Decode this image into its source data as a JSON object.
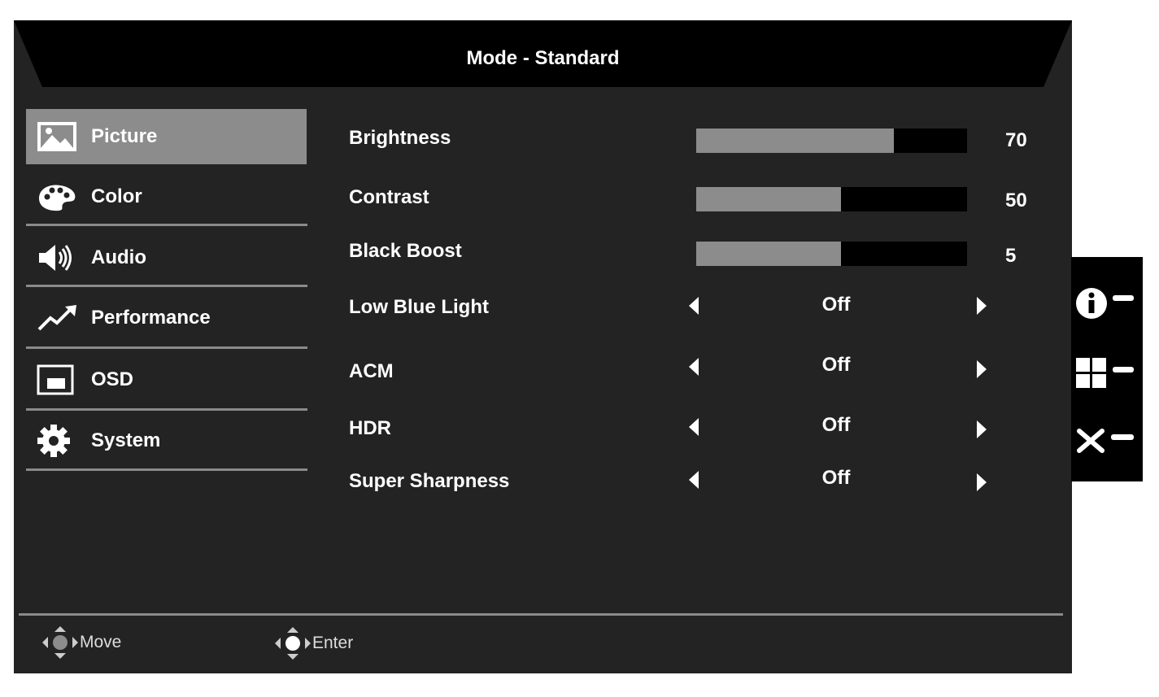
{
  "title": "Mode - Standard",
  "menu": [
    {
      "label": "Picture",
      "icon": "picture-icon",
      "active": true
    },
    {
      "label": "Color",
      "icon": "palette-icon",
      "active": false
    },
    {
      "label": "Audio",
      "icon": "speaker-icon",
      "active": false
    },
    {
      "label": "Performance",
      "icon": "trend-up-icon",
      "active": false
    },
    {
      "label": "OSD",
      "icon": "osd-window-icon",
      "active": false
    },
    {
      "label": "System",
      "icon": "gear-icon",
      "active": false
    }
  ],
  "sliders": [
    {
      "label": "Brightness",
      "value": "70",
      "level": 0.73
    },
    {
      "label": "Contrast",
      "value": "50",
      "level": 0.535
    },
    {
      "label": "Black Boost",
      "value": "5",
      "level": 0.535
    }
  ],
  "options": [
    {
      "label": "Low Blue Light",
      "value": "Off"
    },
    {
      "label": "ACM",
      "value": "Off"
    },
    {
      "label": "HDR",
      "value": "Off"
    },
    {
      "label": "Super Sharpness",
      "value": "Off"
    }
  ],
  "hints": {
    "move": "Move",
    "enter": "Enter"
  },
  "side_keys": [
    "info-key-icon",
    "input-grid-key-icon",
    "close-key-icon"
  ],
  "colors": {
    "panel_bg": "#232323",
    "active_bg": "#8c8c8c",
    "bar_fill": "#8c8c8c",
    "bar_track": "#000000",
    "text": "#ffffff"
  }
}
